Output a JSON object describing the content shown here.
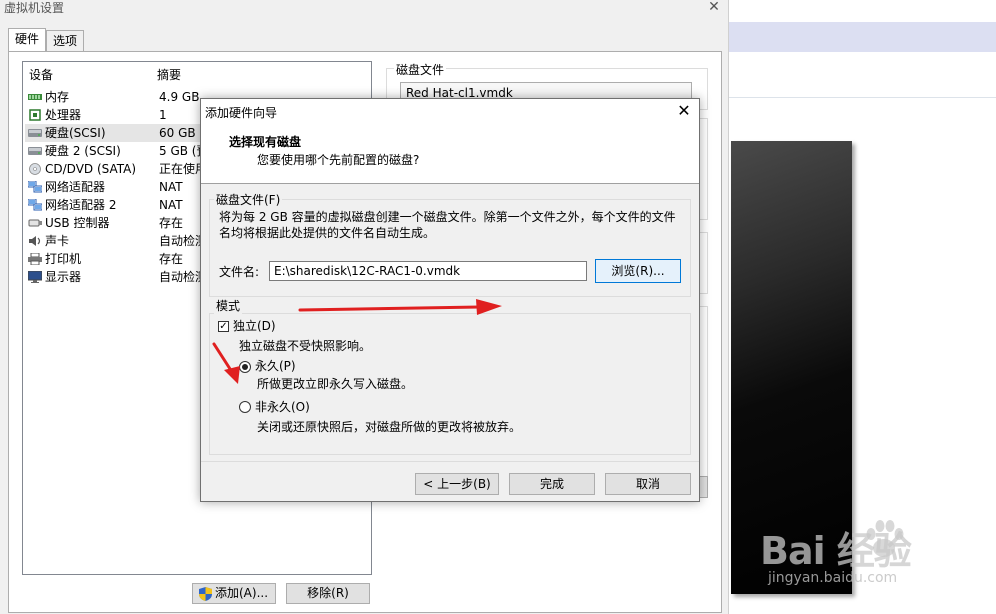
{
  "main_window": {
    "title": "虚拟机设置",
    "close_glyph": "✕",
    "tabs": [
      "硬件",
      "选项"
    ]
  },
  "device_list": {
    "col_device": "设备",
    "col_summary": "摘要",
    "rows": [
      {
        "name": "内存",
        "summary": "4.9 GB",
        "icon": "memory-icon"
      },
      {
        "name": "处理器",
        "summary": "1",
        "icon": "processor-icon"
      },
      {
        "name": "硬盘(SCSI)",
        "summary": "60 GB",
        "icon": "hard-disk-icon"
      },
      {
        "name": "硬盘 2 (SCSI)",
        "summary": "5 GB (预",
        "icon": "hard-disk-icon"
      },
      {
        "name": "CD/DVD (SATA)",
        "summary": "正在使用",
        "icon": "cd-dvd-icon"
      },
      {
        "name": "网络适配器",
        "summary": "NAT",
        "icon": "network-adapter-icon"
      },
      {
        "name": "网络适配器 2",
        "summary": "NAT",
        "icon": "network-adapter-icon"
      },
      {
        "name": "USB 控制器",
        "summary": "存在",
        "icon": "usb-icon"
      },
      {
        "name": "声卡",
        "summary": "自动检测",
        "icon": "sound-card-icon"
      },
      {
        "name": "打印机",
        "summary": "存在",
        "icon": "printer-icon"
      },
      {
        "name": "显示器",
        "summary": "自动检测",
        "icon": "display-icon"
      }
    ]
  },
  "buttons": {
    "add": "添加(A)...",
    "remove": "移除(R)"
  },
  "disk_file_panel": {
    "label": "磁盘文件",
    "value": "Red Hat-cl1.vmdk"
  },
  "wizard": {
    "title": "添加硬件向导",
    "close_glyph": "✕",
    "heading": "选择现有磁盘",
    "subheading": "您要使用哪个先前配置的磁盘?",
    "disk_file_group": {
      "legend": "磁盘文件(F)",
      "description_line1": "将为每 2 GB 容量的虚拟磁盘创建一个磁盘文件。除第一个文件之外，每个文件的文件",
      "description_line2": "名均将根据此处提供的文件名自动生成。",
      "filename_label": "文件名:",
      "filename_value": "E:\\sharedisk\\12C-RAC1-0.vmdk",
      "browse_label": "浏览(R)..."
    },
    "mode_group": {
      "legend": "模式",
      "independent_label": "独立(D)",
      "independent_checked": true,
      "independent_desc": "独立磁盘不受快照影响。",
      "persistent_label": "永久(P)",
      "persistent_desc": "所做更改立即永久写入磁盘。",
      "nonpersistent_label": "非永久(O)",
      "nonpersistent_desc": "关闭或还原快照后，对磁盘所做的更改将被放弃。",
      "selected": "persistent"
    },
    "footer": {
      "back": "< 上一步(B)",
      "finish": "完成",
      "cancel": "取消"
    }
  },
  "watermark": {
    "logo_text": "Bai 经验",
    "url": "jingyan.baidu.com"
  },
  "colors": {
    "annotation_arrow": "#e02020",
    "selected_row": "#e5e5e5",
    "focus_blue": "#0078d7"
  }
}
